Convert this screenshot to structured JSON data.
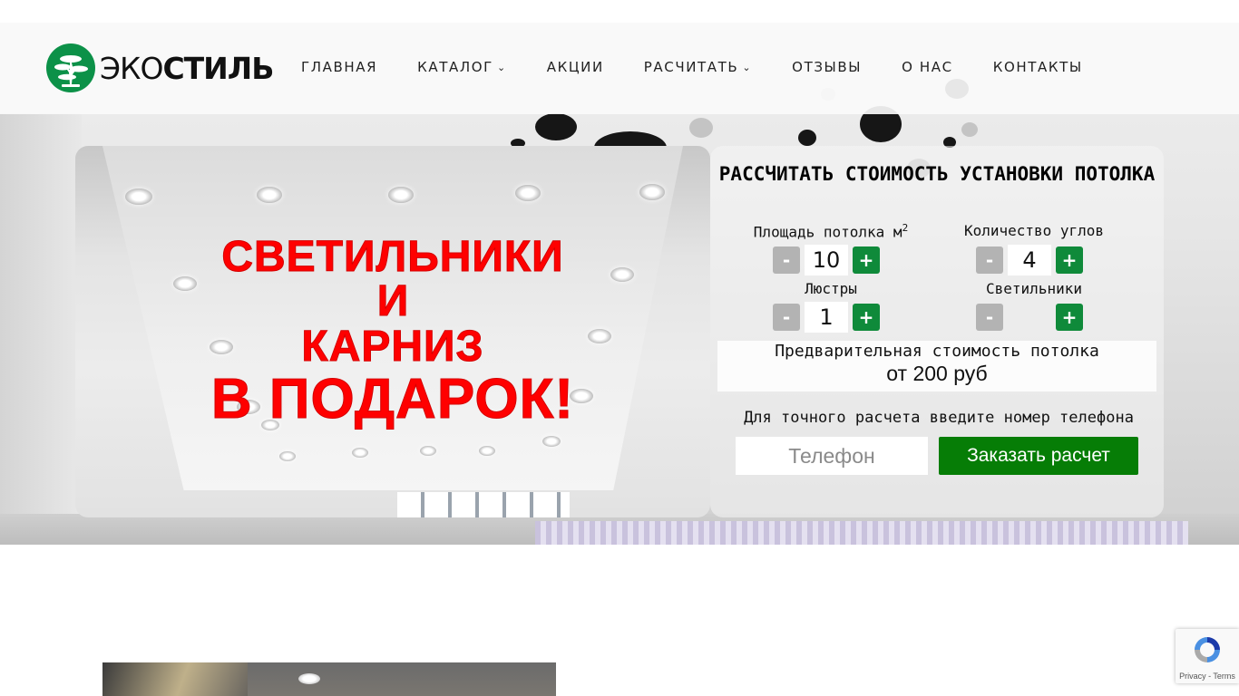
{
  "header": {
    "logo_text_light": "ЭКО",
    "logo_text_bold": "СТИЛЬ",
    "nav": [
      {
        "label": "ГЛАВНАЯ",
        "has_dropdown": false
      },
      {
        "label": "КАТАЛОГ",
        "has_dropdown": true
      },
      {
        "label": "АКЦИИ",
        "has_dropdown": false
      },
      {
        "label": "РАСЧИТАТЬ",
        "has_dropdown": true
      },
      {
        "label": "ОТЗЫВЫ",
        "has_dropdown": false
      },
      {
        "label": "О НАС",
        "has_dropdown": false
      },
      {
        "label": "КОНТАКТЫ",
        "has_dropdown": false
      }
    ],
    "dropdown_icon": "chevron-down-icon"
  },
  "promo": {
    "line1": "СВЕТИЛЬНИКИ",
    "line2": "И",
    "line3": "КАРНИЗ",
    "line4": "В ПОДАРОК!",
    "text_color": "#ff0000"
  },
  "calculator": {
    "title": "РАССЧИТАТЬ СТОИМОСТЬ УСТАНОВКИ ПОТОЛКА",
    "fields": {
      "area": {
        "label": "Площадь потолка м",
        "label_sup": "2",
        "value": "10"
      },
      "corners": {
        "label": "Количество углов",
        "value": "4"
      },
      "chandeliers": {
        "label": "Люстры",
        "value": "1"
      },
      "lamps": {
        "label": "Светильники",
        "value": ""
      }
    },
    "minus_label": "-",
    "plus_label": "+",
    "price_label": "Предварительная стоимость потолка",
    "price_value": "от 200 руб",
    "phone_hint": "Для точного расчета введите номер телефона",
    "phone_placeholder": "Телефон",
    "order_button": "Заказать расчет",
    "colors": {
      "plus": "#0f8a3a",
      "minus": "#b3b3b3",
      "order": "#067d06"
    }
  },
  "recaptcha": {
    "links": "Privacy - Terms",
    "icon": "recaptcha-icon"
  }
}
